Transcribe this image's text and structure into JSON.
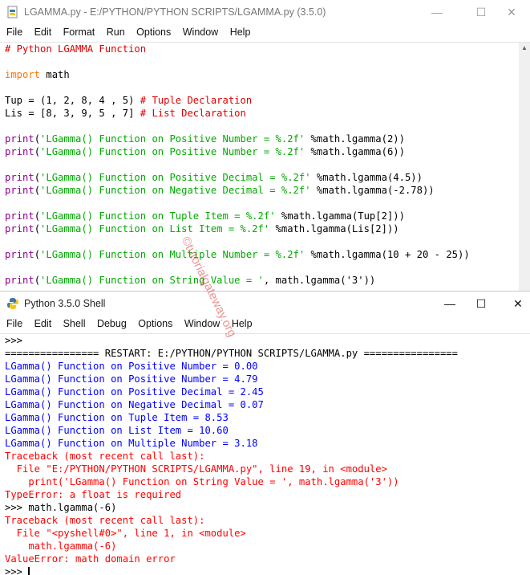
{
  "editor": {
    "title": "LGAMMA.py - E:/PYTHON/PYTHON SCRIPTS/LGAMMA.py (3.5.0)",
    "menu": [
      "File",
      "Edit",
      "Format",
      "Run",
      "Options",
      "Window",
      "Help"
    ],
    "lines": [
      [
        {
          "c": "cm",
          "t": "# Python LGAMMA Function"
        }
      ],
      [],
      [
        {
          "c": "kw",
          "t": "import"
        },
        {
          "c": "df",
          "t": " math"
        }
      ],
      [],
      [
        {
          "c": "df",
          "t": "Tup = (1, 2, 8, 4 , 5) "
        },
        {
          "c": "cm",
          "t": "# Tuple Declaration"
        }
      ],
      [
        {
          "c": "df",
          "t": "Lis = [8, 3, 9, 5 , 7] "
        },
        {
          "c": "cm",
          "t": "# List Declaration"
        }
      ],
      [],
      [
        {
          "c": "bi",
          "t": "print"
        },
        {
          "c": "df",
          "t": "("
        },
        {
          "c": "st",
          "t": "'LGamma() Function on Positive Number = %.2f'"
        },
        {
          "c": "df",
          "t": " %math.lgamma(2))"
        }
      ],
      [
        {
          "c": "bi",
          "t": "print"
        },
        {
          "c": "df",
          "t": "("
        },
        {
          "c": "st",
          "t": "'LGamma() Function on Positive Number = %.2f'"
        },
        {
          "c": "df",
          "t": " %math.lgamma(6))"
        }
      ],
      [],
      [
        {
          "c": "bi",
          "t": "print"
        },
        {
          "c": "df",
          "t": "("
        },
        {
          "c": "st",
          "t": "'LGamma() Function on Positive Decimal = %.2f'"
        },
        {
          "c": "df",
          "t": " %math.lgamma(4.5))"
        }
      ],
      [
        {
          "c": "bi",
          "t": "print"
        },
        {
          "c": "df",
          "t": "("
        },
        {
          "c": "st",
          "t": "'LGamma() Function on Negative Decimal = %.2f'"
        },
        {
          "c": "df",
          "t": " %math.lgamma(-2.78))"
        }
      ],
      [],
      [
        {
          "c": "bi",
          "t": "print"
        },
        {
          "c": "df",
          "t": "("
        },
        {
          "c": "st",
          "t": "'LGamma() Function on Tuple Item = %.2f'"
        },
        {
          "c": "df",
          "t": " %math.lgamma(Tup[2]))"
        }
      ],
      [
        {
          "c": "bi",
          "t": "print"
        },
        {
          "c": "df",
          "t": "("
        },
        {
          "c": "st",
          "t": "'LGamma() Function on List Item = %.2f'"
        },
        {
          "c": "df",
          "t": " %math.lgamma(Lis[2]))"
        }
      ],
      [],
      [
        {
          "c": "bi",
          "t": "print"
        },
        {
          "c": "df",
          "t": "("
        },
        {
          "c": "st",
          "t": "'LGamma() Function on Multiple Number = %.2f'"
        },
        {
          "c": "df",
          "t": " %math.lgamma(10 + 20 - 25))"
        }
      ],
      [],
      [
        {
          "c": "bi",
          "t": "print"
        },
        {
          "c": "df",
          "t": "("
        },
        {
          "c": "st",
          "t": "'LGamma() Function on String Value = '"
        },
        {
          "c": "df",
          "t": ", math.lgamma('3'))"
        }
      ]
    ]
  },
  "shell": {
    "title": "Python 3.5.0 Shell",
    "menu": [
      "File",
      "Edit",
      "Shell",
      "Debug",
      "Options",
      "Window",
      "Help"
    ],
    "lines": [
      [
        {
          "c": "df",
          "t": ">>> "
        }
      ],
      [
        {
          "c": "df",
          "t": "================ RESTART: E:/PYTHON/PYTHON SCRIPTS/LGAMMA.py ================"
        }
      ],
      [
        {
          "c": "out",
          "t": "LGamma() Function on Positive Number = 0.00"
        }
      ],
      [
        {
          "c": "out",
          "t": "LGamma() Function on Positive Number = 4.79"
        }
      ],
      [
        {
          "c": "out",
          "t": "LGamma() Function on Positive Decimal = 2.45"
        }
      ],
      [
        {
          "c": "out",
          "t": "LGamma() Function on Negative Decimal = 0.07"
        }
      ],
      [
        {
          "c": "out",
          "t": "LGamma() Function on Tuple Item = 8.53"
        }
      ],
      [
        {
          "c": "out",
          "t": "LGamma() Function on List Item = 10.60"
        }
      ],
      [
        {
          "c": "out",
          "t": "LGamma() Function on Multiple Number = 3.18"
        }
      ],
      [
        {
          "c": "err",
          "t": "Traceback (most recent call last):"
        }
      ],
      [
        {
          "c": "err",
          "t": "  File \"E:/PYTHON/PYTHON SCRIPTS/LGAMMA.py\", line 19, in <module>"
        }
      ],
      [
        {
          "c": "err",
          "t": "    print('LGamma() Function on String Value = ', math.lgamma('3'))"
        }
      ],
      [
        {
          "c": "err",
          "t": "TypeError: a float is required"
        }
      ],
      [
        {
          "c": "df",
          "t": ">>> math.lgamma(-6)"
        }
      ],
      [
        {
          "c": "err",
          "t": "Traceback (most recent call last):"
        }
      ],
      [
        {
          "c": "err",
          "t": "  File \"<pyshell#0>\", line 1, in <module>"
        }
      ],
      [
        {
          "c": "err",
          "t": "    math.lgamma(-6)"
        }
      ],
      [
        {
          "c": "err",
          "t": "ValueError: math domain error"
        }
      ],
      [
        {
          "c": "df",
          "t": ">>> "
        }
      ]
    ]
  },
  "window_controls": {
    "minimize": "—",
    "maximize": "☐",
    "close": "✕"
  },
  "watermark": "©tutorialgateway.org",
  "colors": {
    "keyword": "#ff7700",
    "comment": "#dd0000",
    "builtin": "#900090",
    "string": "#00aa00",
    "output": "#0000ff",
    "error": "#ff0000"
  }
}
